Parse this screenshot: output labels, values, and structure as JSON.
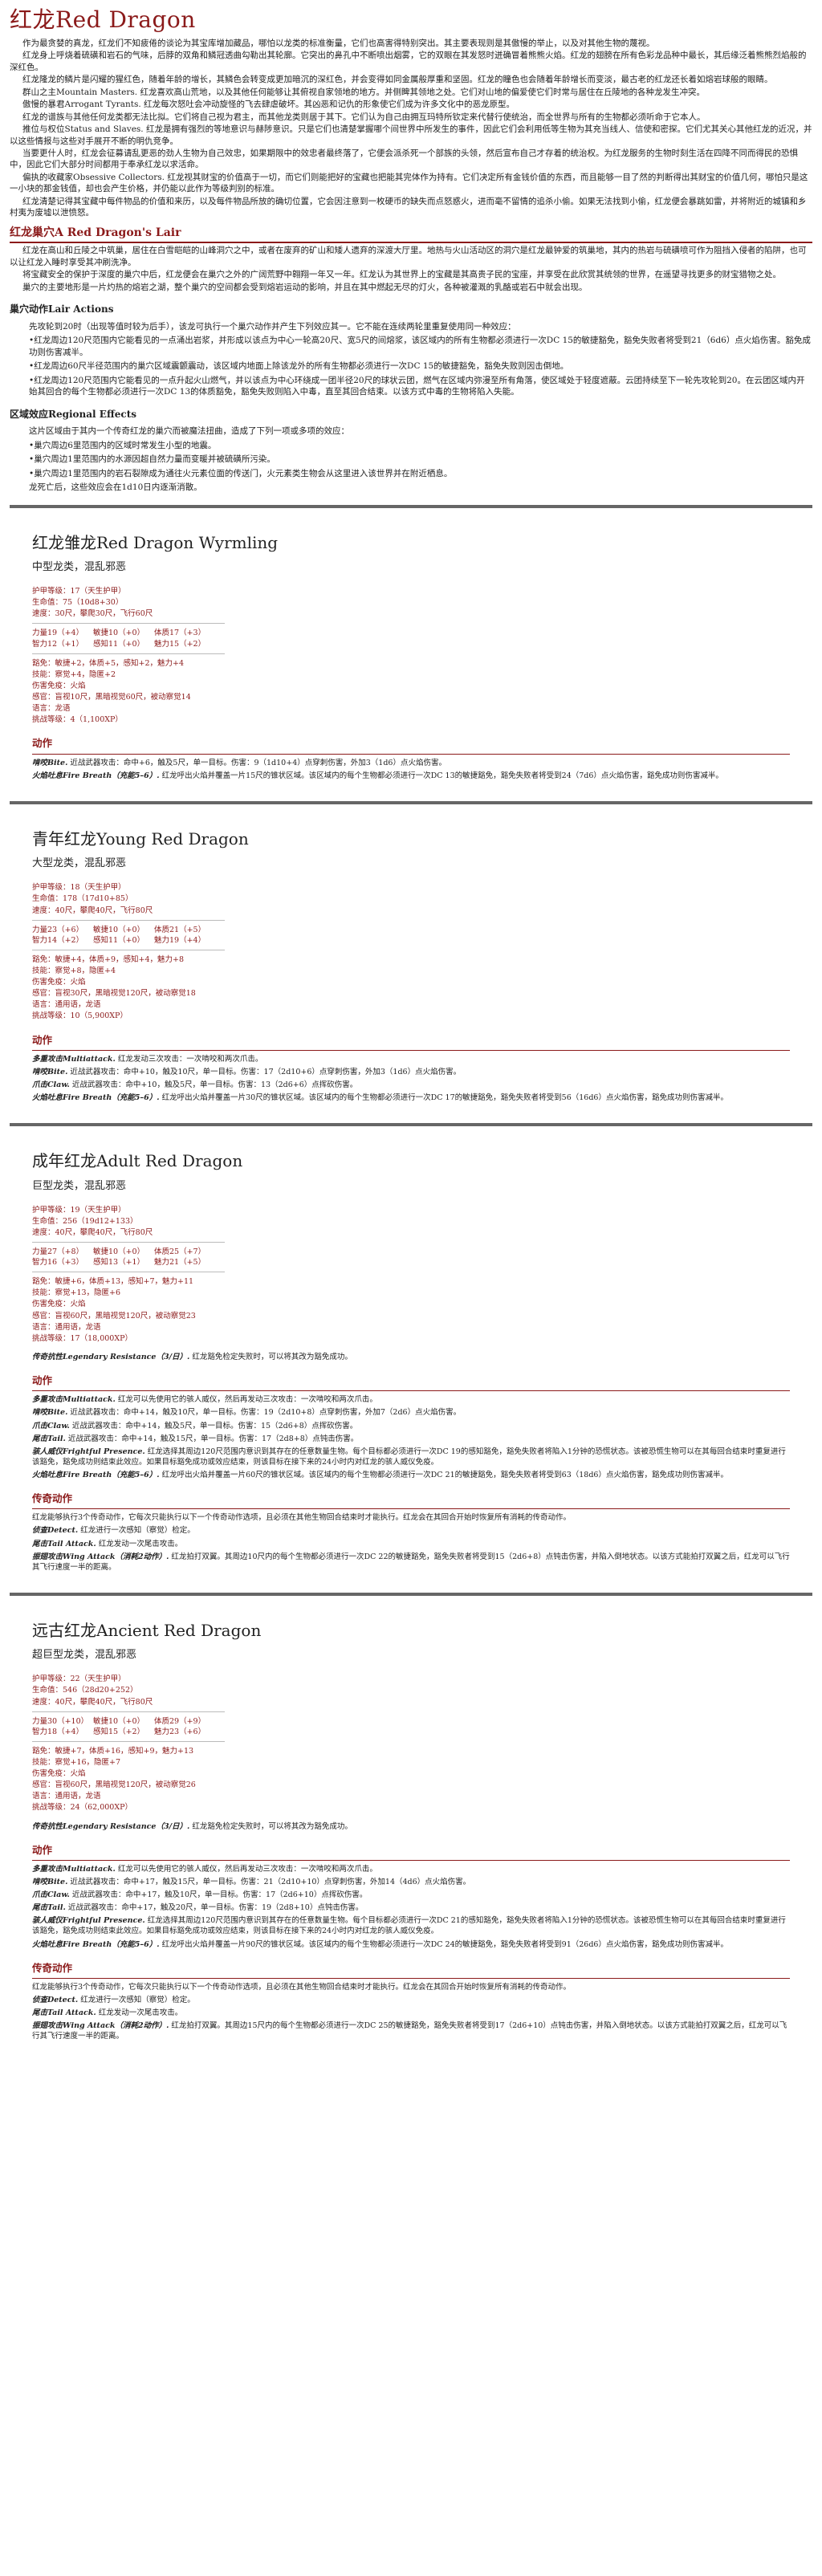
{
  "header": {
    "title": "红龙Red Dragon"
  },
  "intro": [
    "作为最贪婪的真龙，红龙们不知疲倦的谈论为其宝库增加藏品，哪怕以龙类的标准衡量，它们也高害得特别突出。其主要表现则是其傲慢的举止，以及对其他生物的蔑视。",
    "红龙身上呼烧着硫磺和岩石的气味，后脖的双角和鳞冠透曲勾勒出其轮廓。它突出的鼻孔中不断喷出烟雾，它的双眼在其发怒时迸确冒着熊熊火焰。红龙的翅膀在所有色彩龙品种中最长，其后缘泛着熊熊烈焰般的深红色。",
    "红龙隆龙的鳞片是闪耀的猩红色，随着年龄的增长，其鳞色会转变成更加暗沉的深红色，并会变得如同金属般厚重和坚固。红龙的瞳色也会随着年龄增长而变淡，最古老的红龙还长着如熔岩球般的眼睛。",
    "群山之主Mountain Masters. 红龙喜欢高山荒地，以及其他任何能够让其俯视自家领地的地方。并侧睥其领地之处。它们对山地的偏爱使它们时常与居住在丘陵地的各种龙发生冲突。",
    "傲慢的暴君Arrogant Tyrants. 红龙每次怒吐会冲动旋怪的飞去肆虐破坏。其凶恶和记仇的形象使它们成为许多文化中的恶龙原型。",
    "红龙的谱族与其他任何龙类都无法比拟。它们将自己视为君主，而其他龙类则居于其下。它们认为自己由拥互玛特所钦定来代替行使统治，而全世界与所有的生物都必须听命于它本人。",
    "推位与权位Status and Slaves. 红龙是拥有强烈的等地意识与赫陟意识。只是它们也清楚掌握哪个间世界中所发生的事件，因此它们会利用低等生物为其充当线人、信使和密探。它们尤其关心其他红龙的近况，并以这些情报与这些对手展开不断的明仇竞争。",
    "当要更什人时，红龙会征募请乱更恶的劲人生物为自己效忠，如果期限中的效忠者最终落了，它便会派杀死一个部族的头领，然后宣布自己才存着的统治权。为红龙服务的生物时刻生活在四降不同而得民的恐惧中，因此它们大部分时间都用于奉承红龙以求活命。",
    "偏执的收藏家Obsessive Collectors. 红龙视其财宝的价值高于一切，而它们则能把好的宝藏也把能其完体作为持有。它们决定所有金钱价值的东西，而且能够一目了然的判断得出其财宝的价值几何，哪怕只是这一小块的那金钱值，却也会产生价格，并仍能以此作为等级判别的标准。",
    "红龙清楚记得其宝藏中每件物品的价值和来历，以及每件物品所放的确切位置，它会因注意到一枚硬币的缺失而点怒惑火，进而毫不留情的追杀小偷。如果无法找到小偷，红龙便会暴跳如雷，并将附近的城镇和乡村夷为废墟以泄愤怒。"
  ],
  "lair": {
    "heading": "红龙巢穴A Red Dragon's Lair",
    "paragraphs": [
      "红龙在高山和丘陵之中筑巢，居住在白雪皑皑的山峰洞穴之中，或者在废弃的矿山和矮人遗弃的深渡大厅里。地热与火山活动区的洞穴是红龙最钟爱的筑巢地，其内的热岩与硫磺喷可作为阻挡入侵者的陷阱，也可以让红龙入睡时享受其冲刷洗净。",
      "将宝藏安全的保护于深度的巢穴中后，红龙便会在巢穴之外的广阔荒野中翱翔一年又一年。红龙认为其世界上的宝藏是其高贵子民的宝座，并享受在此欣赏其统领的世界，在遥望寻找更多的财宝猎物之处。",
      "巢穴的主要地形是一片灼热的熔岩之湖，整个巢穴的空间都会受到熔岩运动的影响，并且在其中燃起无尽的灯火，各种被灌溉的乳酪或岩石中就会出现。"
    ],
    "actions_title": "巢穴动作Lair Actions",
    "actions_intro": "先攻轮到20时（出现等值时较为后手），该龙可执行一个巢穴动作并产生下列效应其一。它不能在连续两轮里重复使用同一种效应：",
    "actions": [
      "•红龙周边120尺范围内它能看见的一点涌出岩浆，并形成以该点为中心一轮高20尺、宽5尺的间熔浆，该区域内的所有生物都必须进行一次DC 15的敏捷豁免，豁免失败者将受到21（6d6）点火焰伤害。豁免成功则伤害减半。",
      "•红龙周边60尺半径范围内的巢穴区域震颤震动，该区域内地面上除该龙外的所有生物都必须进行一次DC 15的敏捷豁免，豁免失败则因击倒地。",
      "•红龙周边120尺范围内它能看见的一点升起火山燃气，并以该点为中心环绕成一团半径20尺的球状云团，燃气在区域内弥漫至所有角落，使区域处于轻度遮蔽。云团持续至下一轮先攻轮到20。在云团区域内开始其回合的每个生物都必须进行一次DC 13的体质豁免，豁免失败则陷入中毒，直至其回合结束。以该方式中毒的生物将陷入失能。"
    ],
    "effects_title": "区域效应Regional Effects",
    "effects_intro": "这片区域由于其内一个传奇红龙的巢穴而被魔法扭曲，造成了下列一项或多项的效应：",
    "effects": [
      "•巢穴周边6里范围内的区域时常发生小型的地震。",
      "•巢穴周边1里范围内的水源因超自然力量而变暖并被硫磺所污染。",
      "•巢穴周边1里范围内的岩石裂隙成为通往火元素位面的传送门，火元素类生物会从这里进入该世界并在附近栖息。"
    ],
    "effects_outro": "龙死亡后，这些效应会在1d10日内逐渐消散。"
  },
  "wyrmling": {
    "name": "红龙雏龙Red Dragon Wyrmling",
    "type": "中型龙类，混乱邪恶",
    "ac": "护甲等级：17（天生护甲）",
    "hp": "生命值：75（10d8+30）",
    "speed": "速度：30尺，攀爬30尺，飞行60尺",
    "abilities": [
      "力量19（+4）",
      "敏捷10（+0）",
      "体质17（+3）",
      "智力12（+1）",
      "感知11（+0）",
      "魅力15（+2）"
    ],
    "saves": "豁免：敏捷+2，体质+5，感知+2，魅力+4",
    "skills": "技能：察觉+4，隐匿+2",
    "immunities": "伤害免疫：火焰",
    "senses": "感官：盲视10尺，黑暗视觉60尺，被动察觉14",
    "languages": "语言：龙语",
    "challenge": "挑战等级：4（1,100XP）",
    "actions": [
      {
        "name": "啃咬Bite.",
        "text": "近战武器攻击：命中+6，触及5尺，单一目标。伤害：9（1d10+4）点穿刺伤害，外加3（1d6）点火焰伤害。"
      },
      {
        "name": "火焰吐息Fire Breath（充能5–6）.",
        "text": "红龙呼出火焰并覆盖一片15尺的锥状区域。该区域内的每个生物都必须进行一次DC 13的敏捷豁免，豁免失败者将受到24（7d6）点火焰伤害，豁免成功则伤害减半。"
      }
    ]
  },
  "young": {
    "name": "青年红龙Young Red Dragon",
    "type": "大型龙类，混乱邪恶",
    "ac": "护甲等级：18（天生护甲）",
    "hp": "生命值：178（17d10+85）",
    "speed": "速度：40尺，攀爬40尺，飞行80尺",
    "abilities": [
      "力量23（+6）",
      "敏捷10（+0）",
      "体质21（+5）",
      "智力14（+2）",
      "感知11（+0）",
      "魅力19（+4）"
    ],
    "saves": "豁免：敏捷+4，体质+9，感知+4，魅力+8",
    "skills": "技能：察觉+8，隐匿+4",
    "immunities": "伤害免疫：火焰",
    "senses": "感官：盲视30尺，黑暗视觉120尺，被动察觉18",
    "languages": "语言：通用语，龙语",
    "challenge": "挑战等级：10（5,900XP）",
    "actions": [
      {
        "name": "多重攻击Multiattack.",
        "text": "红龙发动三次攻击：一次啃咬和两次爪击。"
      },
      {
        "name": "啃咬Bite.",
        "text": "近战武器攻击：命中+10，触及10尺，单一目标。伤害：17（2d10+6）点穿刺伤害，外加3（1d6）点火焰伤害。"
      },
      {
        "name": "爪击Claw.",
        "text": "近战武器攻击：命中+10，触及5尺，单一目标。伤害：13（2d6+6）点挥砍伤害。"
      },
      {
        "name": "火焰吐息Fire Breath（充能5–6）.",
        "text": "红龙呼出火焰并覆盖一片30尺的锥状区域。该区域内的每个生物都必须进行一次DC 17的敏捷豁免，豁免失败者将受到56（16d6）点火焰伤害，豁免成功则伤害减半。"
      }
    ]
  },
  "adult": {
    "name": "成年红龙Adult Red Dragon",
    "type": "巨型龙类，混乱邪恶",
    "ac": "护甲等级：19（天生护甲）",
    "hp": "生命值：256（19d12+133）",
    "speed": "速度：40尺，攀爬40尺，飞行80尺",
    "abilities": [
      "力量27（+8）",
      "敏捷10（+0）",
      "体质25（+7）",
      "智力16（+3）",
      "感知13（+1）",
      "魅力21（+5）"
    ],
    "saves": "豁免：敏捷+6，体质+13，感知+7，魅力+11",
    "skills": "技能：察觉+13，隐匿+6",
    "immunities": "伤害免疫：火焰",
    "senses": "感官：盲视60尺，黑暗视觉120尺，被动察觉23",
    "languages": "语言：通用语，龙语",
    "challenge": "挑战等级：17（18,000XP）",
    "traits": [
      {
        "name": "传奇抗性Legendary Resistance（3/日）.",
        "text": "红龙豁免检定失败时，可以将其改为豁免成功。"
      }
    ],
    "actions": [
      {
        "name": "多重攻击Multiattack.",
        "text": "红龙可以先使用它的骇人威仪，然后再发动三次攻击：一次啃咬和两次爪击。"
      },
      {
        "name": "啃咬Bite.",
        "text": "近战武器攻击：命中+14，触及10尺，单一目标。伤害：19（2d10+8）点穿刺伤害，外加7（2d6）点火焰伤害。"
      },
      {
        "name": "爪击Claw.",
        "text": "近战武器攻击：命中+14，触及5尺，单一目标。伤害：15（2d6+8）点挥砍伤害。"
      },
      {
        "name": "尾击Tail.",
        "text": "近战武器攻击：命中+14，触及15尺，单一目标。伤害：17（2d8+8）点钝击伤害。"
      },
      {
        "name": "骇人威仪Frightful Presence.",
        "text": "红龙选择其周边120尺范围内意识到其存在的任意数量生物。每个目标都必须进行一次DC 19的感知豁免，豁免失败者将陷入1分钟的恐慌状态。该被恐慌生物可以在其每回合结束时重复进行该豁免，豁免成功则结束此效应。如果目标豁免成功或效应结束，则该目标在接下来的24小时内对红龙的骇人威仪免疫。"
      },
      {
        "name": "火焰吐息Fire Breath（充能5–6）.",
        "text": "红龙呼出火焰并覆盖一片60尺的锥状区域。该区域内的每个生物都必须进行一次DC 21的敏捷豁免，豁免失败者将受到63（18d6）点火焰伤害，豁免成功则伤害减半。"
      }
    ],
    "legendary_intro": "红龙能够执行3个传奇动作，它每次只能执行以下一个传奇动作选项，且必须在其他生物回合结束时才能执行。红龙会在其回合开始时恢复所有消耗的传奇动作。",
    "legendary": [
      {
        "name": "侦查Detect.",
        "text": "红龙进行一次感知（察觉）检定。"
      },
      {
        "name": "尾击Tail Attack.",
        "text": "红龙发动一次尾击攻击。"
      },
      {
        "name": "振翅攻击Wing Attack（消耗2动作）.",
        "text": "红龙拍打双翼。其周边10尺内的每个生物都必须进行一次DC 22的敏捷豁免，豁免失败者将受到15（2d6+8）点钝击伤害，并陷入倒地状态。以该方式能拍打双翼之后，红龙可以飞行其飞行速度一半的距离。"
      }
    ]
  },
  "ancient": {
    "name": "远古红龙Ancient Red Dragon",
    "type": "超巨型龙类，混乱邪恶",
    "ac": "护甲等级：22（天生护甲）",
    "hp": "生命值：546（28d20+252）",
    "speed": "速度：40尺，攀爬40尺，飞行80尺",
    "abilities": [
      "力量30（+10）",
      "敏捷10（+0）",
      "体质29（+9）",
      "智力18（+4）",
      "感知15（+2）",
      "魅力23（+6）"
    ],
    "saves": "豁免：敏捷+7，体质+16，感知+9，魅力+13",
    "skills": "技能：察觉+16，隐匿+7",
    "immunities": "伤害免疫：火焰",
    "senses": "感官：盲视60尺，黑暗视觉120尺，被动察觉26",
    "languages": "语言：通用语，龙语",
    "challenge": "挑战等级：24（62,000XP）",
    "traits": [
      {
        "name": "传奇抗性Legendary Resistance（3/日）.",
        "text": "红龙豁免检定失败时，可以将其改为豁免成功。"
      }
    ],
    "actions": [
      {
        "name": "多重攻击Multiattack.",
        "text": "红龙可以先使用它的骇人威仪，然后再发动三次攻击：一次啃咬和两次爪击。"
      },
      {
        "name": "啃咬Bite.",
        "text": "近战武器攻击：命中+17，触及15尺，单一目标。伤害：21（2d10+10）点穿刺伤害，外加14（4d6）点火焰伤害。"
      },
      {
        "name": "爪击Claw.",
        "text": "近战武器攻击：命中+17，触及10尺，单一目标。伤害：17（2d6+10）点挥砍伤害。"
      },
      {
        "name": "尾击Tail.",
        "text": "近战武器攻击：命中+17，触及20尺，单一目标。伤害：19（2d8+10）点钝击伤害。"
      },
      {
        "name": "骇人威仪Frightful Presence.",
        "text": "红龙选择其周边120尺范围内意识到其存在的任意数量生物。每个目标都必须进行一次DC 21的感知豁免，豁免失败者将陷入1分钟的恐慌状态。该被恐慌生物可以在其每回合结束时重复进行该豁免，豁免成功则结束此效应。如果目标豁免成功或效应结束，则该目标在接下来的24小时内对红龙的骇人威仪免疫。"
      },
      {
        "name": "火焰吐息Fire Breath（充能5–6）.",
        "text": "红龙呼出火焰并覆盖一片90尺的锥状区域。该区域内的每个生物都必须进行一次DC 24的敏捷豁免，豁免失败者将受到91（26d6）点火焰伤害，豁免成功则伤害减半。"
      }
    ],
    "legendary_intro": "红龙能够执行3个传奇动作，它每次只能执行以下一个传奇动作选项，且必须在其他生物回合结束时才能执行。红龙会在其回合开始时恢复所有消耗的传奇动作。",
    "legendary": [
      {
        "name": "侦查Detect.",
        "text": "红龙进行一次感知（察觉）检定。"
      },
      {
        "name": "尾击Tail Attack.",
        "text": "红龙发动一次尾击攻击。"
      },
      {
        "name": "振翅攻击Wing Attack（消耗2动作）.",
        "text": "红龙拍打双翼。其周边15尺内的每个生物都必须进行一次DC 25的敏捷豁免，豁免失败者将受到17（2d6+10）点钝击伤害，并陷入倒地状态。以该方式能拍打双翼之后，红龙可以飞行其飞行速度一半的距离。"
      }
    ]
  },
  "labels": {
    "actions": "动作",
    "legendary_actions": "传奇动作"
  }
}
